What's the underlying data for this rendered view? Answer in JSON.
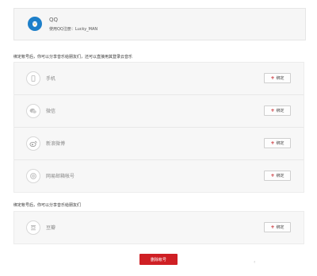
{
  "qq_account": {
    "name": "QQ",
    "account_text": "使用QQ注册：Lucky_MAN"
  },
  "section1": {
    "note": "绑定帐号后，你可以分享音乐给朋友们，还可以直接用其登录云音乐",
    "items": [
      {
        "label": "手机",
        "icon": "phone-icon",
        "button": "绑定"
      },
      {
        "label": "微信",
        "icon": "wechat-icon",
        "button": "绑定"
      },
      {
        "label": "新浪微博",
        "icon": "weibo-icon",
        "button": "绑定"
      },
      {
        "label": "网易邮箱帐号",
        "icon": "netease-mail-icon",
        "button": "绑定"
      }
    ]
  },
  "section2": {
    "note": "绑定帐号后，你可以分享音乐给朋友们",
    "items": [
      {
        "label": "豆瓣",
        "icon": "douban-icon",
        "button": "绑定"
      }
    ]
  },
  "actions": {
    "delete_label": "删除帐号"
  },
  "colors": {
    "accent": "#cf1f24",
    "qq_blue": "#1d7fc9"
  }
}
